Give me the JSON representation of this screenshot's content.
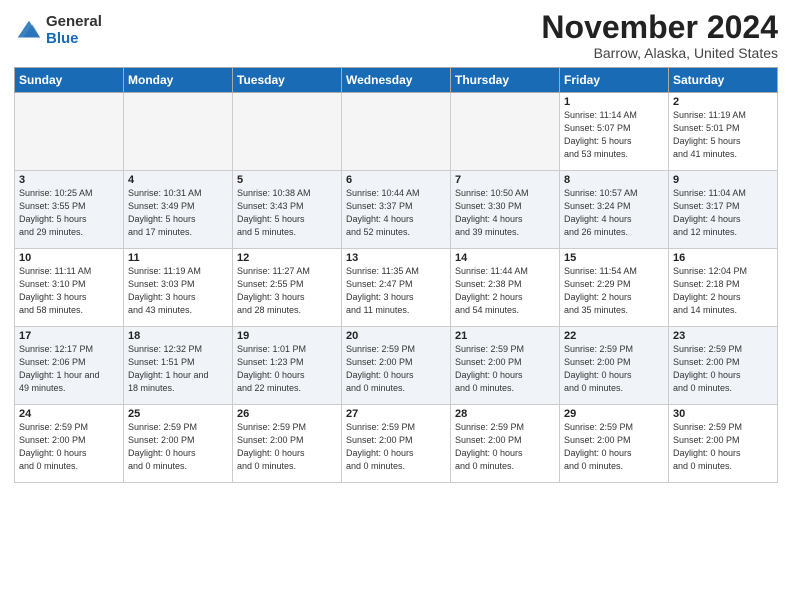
{
  "logo": {
    "general": "General",
    "blue": "Blue"
  },
  "title": "November 2024",
  "location": "Barrow, Alaska, United States",
  "weekdays": [
    "Sunday",
    "Monday",
    "Tuesday",
    "Wednesday",
    "Thursday",
    "Friday",
    "Saturday"
  ],
  "weeks": [
    [
      {
        "day": "",
        "info": ""
      },
      {
        "day": "",
        "info": ""
      },
      {
        "day": "",
        "info": ""
      },
      {
        "day": "",
        "info": ""
      },
      {
        "day": "",
        "info": ""
      },
      {
        "day": "1",
        "info": "Sunrise: 11:14 AM\nSunset: 5:07 PM\nDaylight: 5 hours\nand 53 minutes."
      },
      {
        "day": "2",
        "info": "Sunrise: 11:19 AM\nSunset: 5:01 PM\nDaylight: 5 hours\nand 41 minutes."
      }
    ],
    [
      {
        "day": "3",
        "info": "Sunrise: 10:25 AM\nSunset: 3:55 PM\nDaylight: 5 hours\nand 29 minutes."
      },
      {
        "day": "4",
        "info": "Sunrise: 10:31 AM\nSunset: 3:49 PM\nDaylight: 5 hours\nand 17 minutes."
      },
      {
        "day": "5",
        "info": "Sunrise: 10:38 AM\nSunset: 3:43 PM\nDaylight: 5 hours\nand 5 minutes."
      },
      {
        "day": "6",
        "info": "Sunrise: 10:44 AM\nSunset: 3:37 PM\nDaylight: 4 hours\nand 52 minutes."
      },
      {
        "day": "7",
        "info": "Sunrise: 10:50 AM\nSunset: 3:30 PM\nDaylight: 4 hours\nand 39 minutes."
      },
      {
        "day": "8",
        "info": "Sunrise: 10:57 AM\nSunset: 3:24 PM\nDaylight: 4 hours\nand 26 minutes."
      },
      {
        "day": "9",
        "info": "Sunrise: 11:04 AM\nSunset: 3:17 PM\nDaylight: 4 hours\nand 12 minutes."
      }
    ],
    [
      {
        "day": "10",
        "info": "Sunrise: 11:11 AM\nSunset: 3:10 PM\nDaylight: 3 hours\nand 58 minutes."
      },
      {
        "day": "11",
        "info": "Sunrise: 11:19 AM\nSunset: 3:03 PM\nDaylight: 3 hours\nand 43 minutes."
      },
      {
        "day": "12",
        "info": "Sunrise: 11:27 AM\nSunset: 2:55 PM\nDaylight: 3 hours\nand 28 minutes."
      },
      {
        "day": "13",
        "info": "Sunrise: 11:35 AM\nSunset: 2:47 PM\nDaylight: 3 hours\nand 11 minutes."
      },
      {
        "day": "14",
        "info": "Sunrise: 11:44 AM\nSunset: 2:38 PM\nDaylight: 2 hours\nand 54 minutes."
      },
      {
        "day": "15",
        "info": "Sunrise: 11:54 AM\nSunset: 2:29 PM\nDaylight: 2 hours\nand 35 minutes."
      },
      {
        "day": "16",
        "info": "Sunrise: 12:04 PM\nSunset: 2:18 PM\nDaylight: 2 hours\nand 14 minutes."
      }
    ],
    [
      {
        "day": "17",
        "info": "Sunrise: 12:17 PM\nSunset: 2:06 PM\nDaylight: 1 hour and\n49 minutes."
      },
      {
        "day": "18",
        "info": "Sunrise: 12:32 PM\nSunset: 1:51 PM\nDaylight: 1 hour and\n18 minutes."
      },
      {
        "day": "19",
        "info": "Sunrise: 1:01 PM\nSunset: 1:23 PM\nDaylight: 0 hours\nand 22 minutes."
      },
      {
        "day": "20",
        "info": "Sunrise: 2:59 PM\nSunset: 2:00 PM\nDaylight: 0 hours\nand 0 minutes."
      },
      {
        "day": "21",
        "info": "Sunrise: 2:59 PM\nSunset: 2:00 PM\nDaylight: 0 hours\nand 0 minutes."
      },
      {
        "day": "22",
        "info": "Sunrise: 2:59 PM\nSunset: 2:00 PM\nDaylight: 0 hours\nand 0 minutes."
      },
      {
        "day": "23",
        "info": "Sunrise: 2:59 PM\nSunset: 2:00 PM\nDaylight: 0 hours\nand 0 minutes."
      }
    ],
    [
      {
        "day": "24",
        "info": "Sunrise: 2:59 PM\nSunset: 2:00 PM\nDaylight: 0 hours\nand 0 minutes."
      },
      {
        "day": "25",
        "info": "Sunrise: 2:59 PM\nSunset: 2:00 PM\nDaylight: 0 hours\nand 0 minutes."
      },
      {
        "day": "26",
        "info": "Sunrise: 2:59 PM\nSunset: 2:00 PM\nDaylight: 0 hours\nand 0 minutes."
      },
      {
        "day": "27",
        "info": "Sunrise: 2:59 PM\nSunset: 2:00 PM\nDaylight: 0 hours\nand 0 minutes."
      },
      {
        "day": "28",
        "info": "Sunrise: 2:59 PM\nSunset: 2:00 PM\nDaylight: 0 hours\nand 0 minutes."
      },
      {
        "day": "29",
        "info": "Sunrise: 2:59 PM\nSunset: 2:00 PM\nDaylight: 0 hours\nand 0 minutes."
      },
      {
        "day": "30",
        "info": "Sunrise: 2:59 PM\nSunset: 2:00 PM\nDaylight: 0 hours\nand 0 minutes."
      }
    ]
  ]
}
